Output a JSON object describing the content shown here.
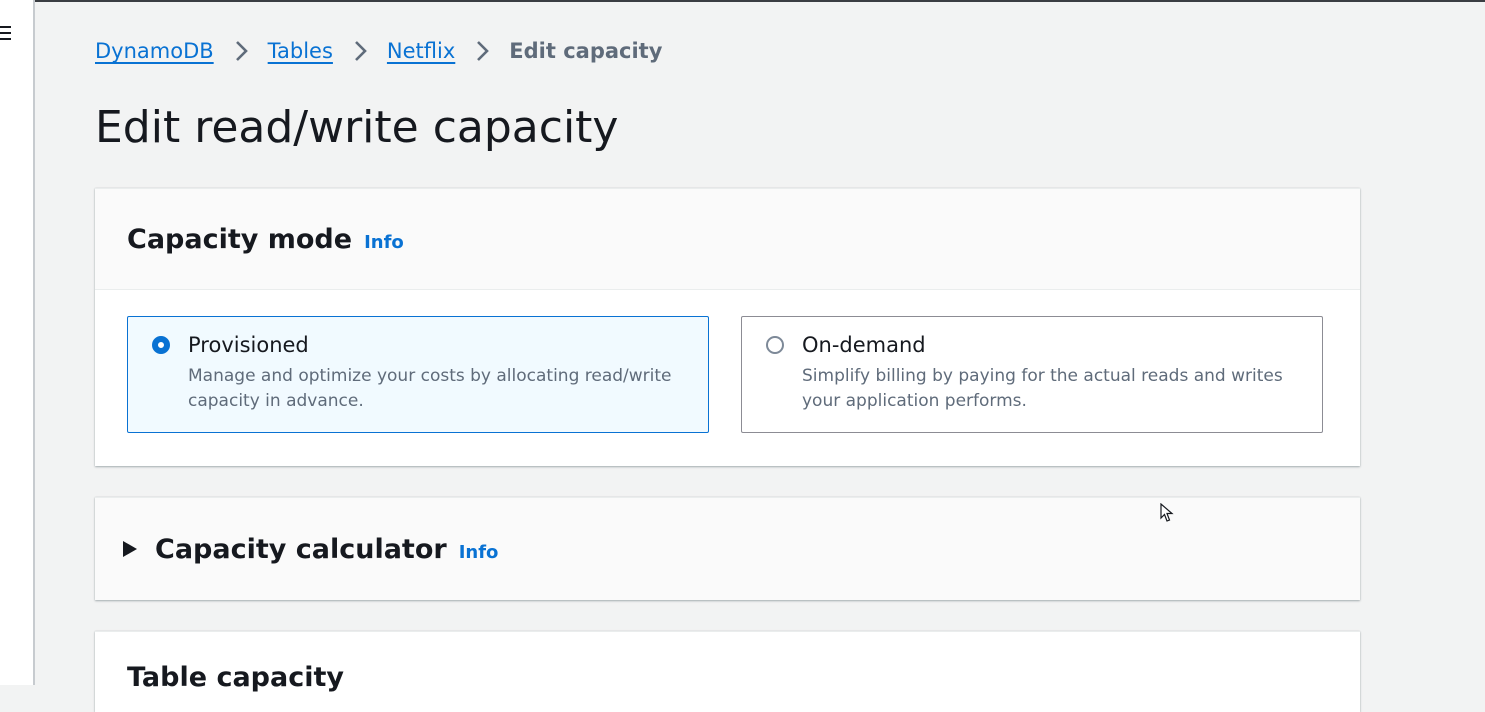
{
  "breadcrumb": {
    "items": [
      "DynamoDB",
      "Tables",
      "Netflix"
    ],
    "current": "Edit capacity"
  },
  "page": {
    "title": "Edit read/write capacity"
  },
  "capacity_mode": {
    "heading": "Capacity mode",
    "info": "Info",
    "options": [
      {
        "label": "Provisioned",
        "description": "Manage and optimize your costs by allocating read/write capacity in advance.",
        "selected": true
      },
      {
        "label": "On-demand",
        "description": "Simplify billing by paying for the actual reads and writes your application performs.",
        "selected": false
      }
    ]
  },
  "capacity_calculator": {
    "heading": "Capacity calculator",
    "info": "Info",
    "expanded": false
  },
  "table_capacity": {
    "heading": "Table capacity"
  },
  "colors": {
    "accent": "#0972d3",
    "background": "#f2f3f3",
    "selected_tile_bg": "#f1faff"
  }
}
